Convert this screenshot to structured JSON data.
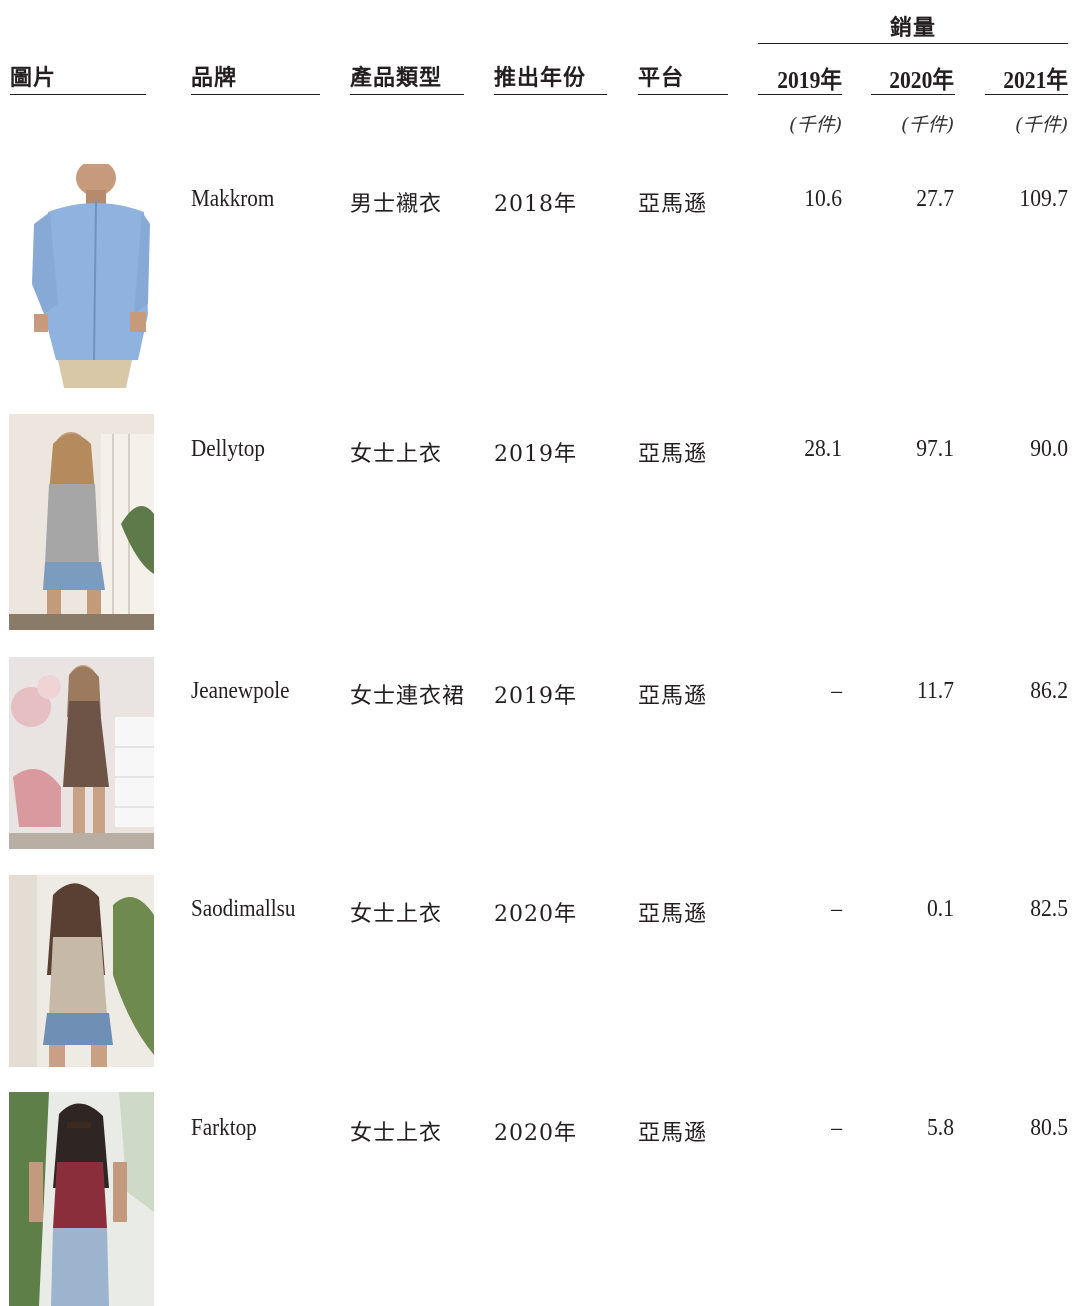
{
  "header": {
    "sales_group_label": "銷量",
    "columns": {
      "image": "圖片",
      "brand": "品牌",
      "product_type": "產品類型",
      "launch_year": "推出年份",
      "platform": "平台"
    },
    "years": [
      "2019年",
      "2020年",
      "2021年"
    ],
    "unit": "(千件)"
  },
  "rows": [
    {
      "photo": "mens-blue-shirt-photo",
      "brand": "Makkrom",
      "product_type": "男士襯衣",
      "launch_year": "2018年",
      "platform": "亞馬遜",
      "sales": [
        "10.6",
        "27.7",
        "109.7"
      ]
    },
    {
      "photo": "womens-grey-tank-top-photo",
      "brand": "Dellytop",
      "product_type": "女士上衣",
      "launch_year": "2019年",
      "platform": "亞馬遜",
      "sales": [
        "28.1",
        "97.1",
        "90.0"
      ]
    },
    {
      "photo": "womens-floral-dress-photo",
      "brand": "Jeanewpole",
      "product_type": "女士連衣裙",
      "launch_year": "2019年",
      "platform": "亞馬遜",
      "sales": [
        "–",
        "11.7",
        "86.2"
      ]
    },
    {
      "photo": "womens-beige-tank-top-photo",
      "brand": "Saodimallsu",
      "product_type": "女士上衣",
      "launch_year": "2020年",
      "platform": "亞馬遜",
      "sales": [
        "–",
        "0.1",
        "82.5"
      ]
    },
    {
      "photo": "womens-burgundy-tank-top-photo",
      "brand": "Farktop",
      "product_type": "女士上衣",
      "launch_year": "2020年",
      "platform": "亞馬遜",
      "sales": [
        "–",
        "5.8",
        "80.5"
      ]
    }
  ]
}
